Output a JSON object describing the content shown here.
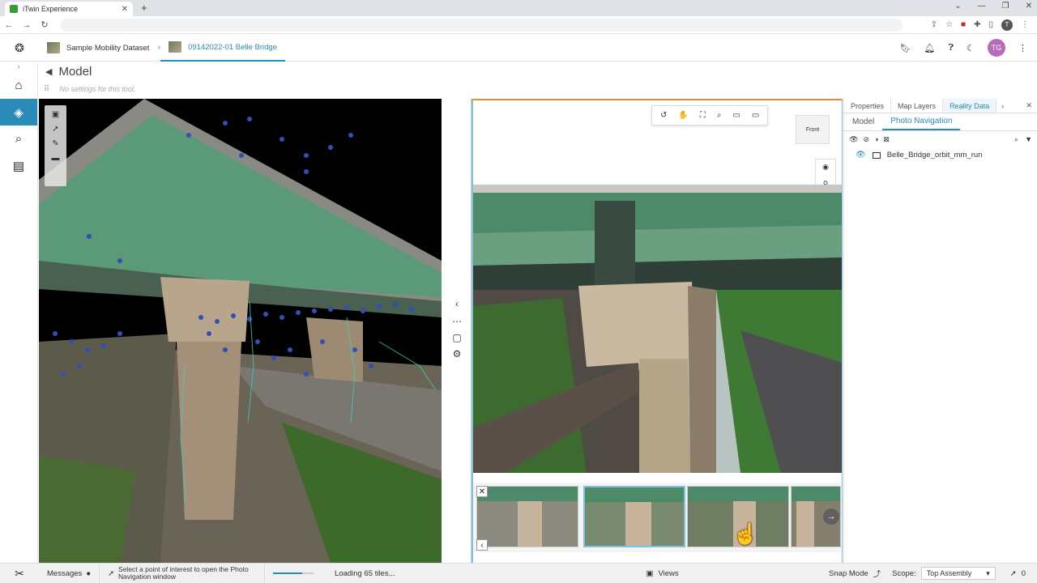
{
  "browser": {
    "tab_title": "iTwin Experience",
    "new_tab": "+",
    "profile_initial": "T"
  },
  "header": {
    "breadcrumb_project": "Sample Mobility Dataset",
    "breadcrumb_imodel": "09142022-01 Belle Bridge",
    "user_initials": "TG"
  },
  "tool": {
    "title": "Model",
    "note": "No settings for this tool."
  },
  "viewer": {
    "cube_label": "Front"
  },
  "panel": {
    "tabs": [
      "Properties",
      "Map Layers",
      "Reality Data"
    ],
    "subtabs": [
      "Model",
      "Photo Navigation"
    ],
    "tree_item": "Belle_Bridge_orbit_mm_run"
  },
  "status": {
    "messages": "Messages",
    "prompt": "Select a point of interest to open the Photo Navigation window",
    "loading": "Loading 65 tiles...",
    "loading_progress": 0.72,
    "views": "Views",
    "snap": "Snap Mode",
    "scope_label": "Scope:",
    "scope_value": "Top Assembly",
    "selection_count": "0"
  },
  "colors": {
    "accent": "#2a8ab8",
    "active_frame": "#e08a3a",
    "avatar": "#b86bb8"
  }
}
